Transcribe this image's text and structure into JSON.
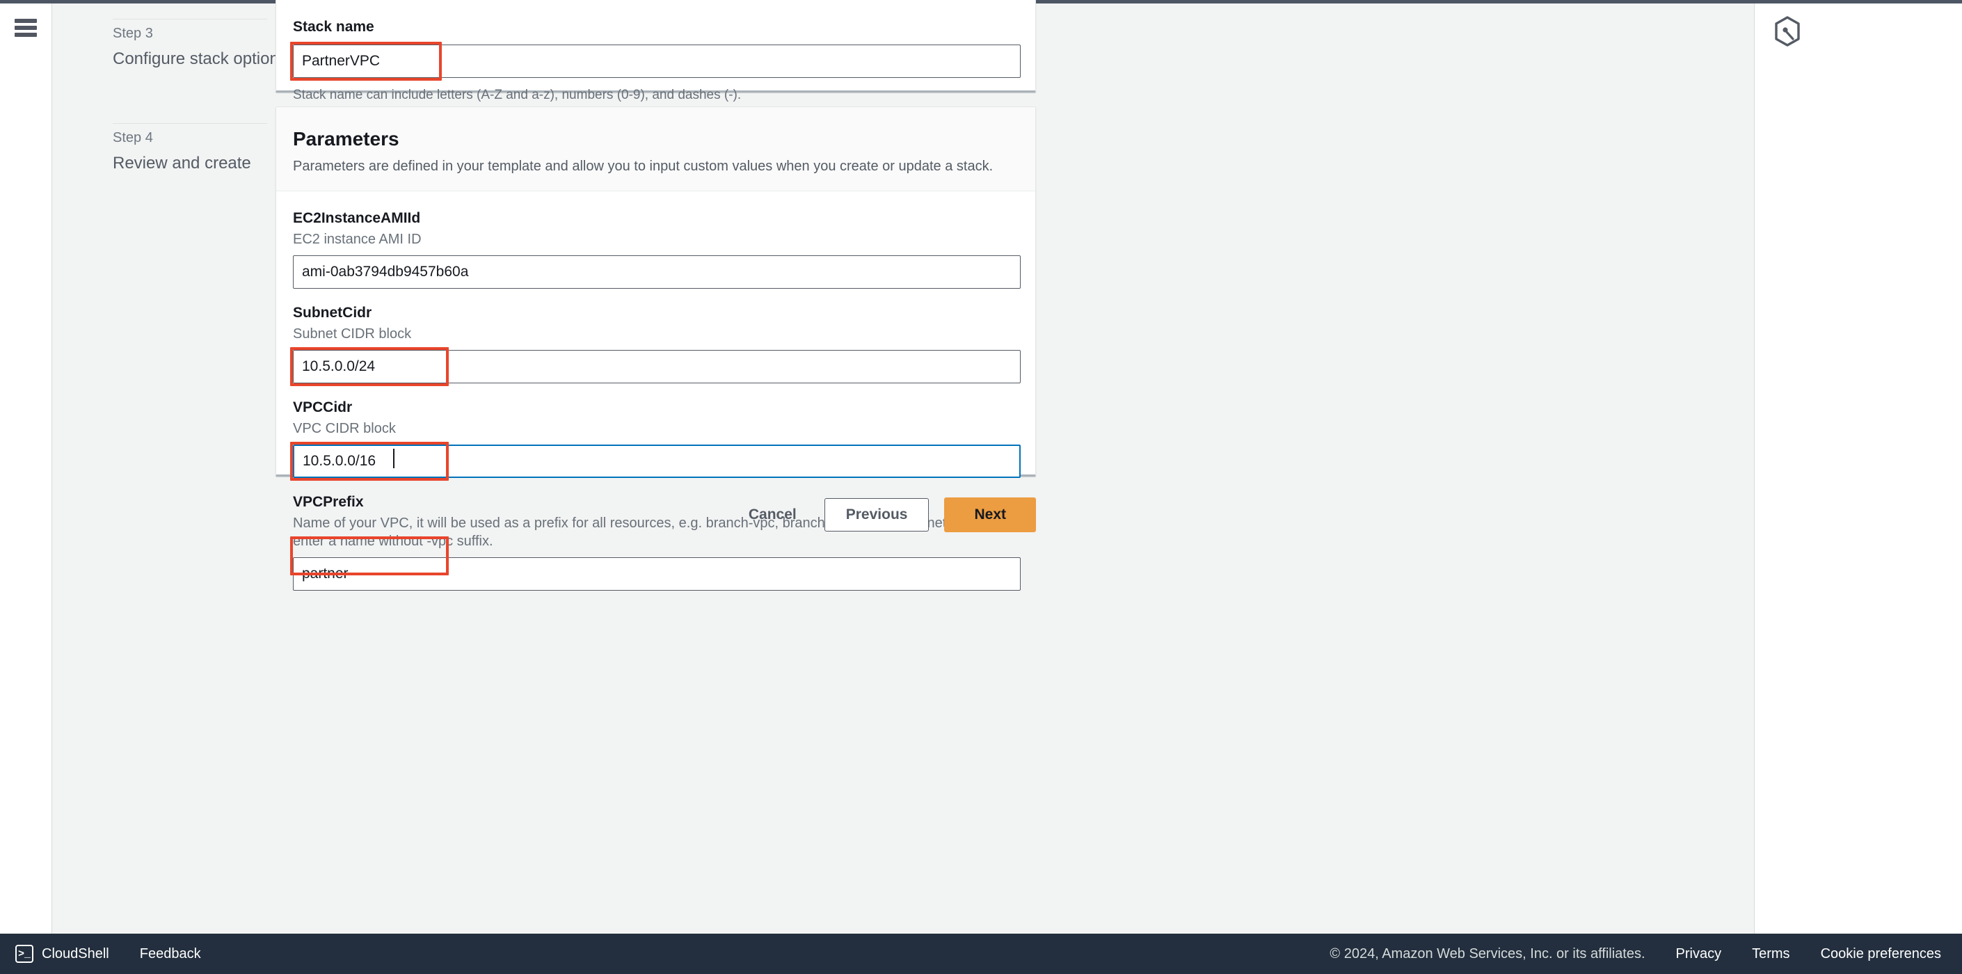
{
  "wizard": {
    "steps": [
      {
        "number": "Step 3",
        "title": "Configure stack options"
      },
      {
        "number": "Step 4",
        "title": "Review and create"
      }
    ]
  },
  "stack_name_card": {
    "label": "Stack name",
    "value": "PartnerVPC",
    "hint": "Stack name can include letters (A-Z and a-z), numbers (0-9), and dashes (-)."
  },
  "parameters": {
    "title": "Parameters",
    "description": "Parameters are defined in your template and allow you to input custom values when you create or update a stack.",
    "items": [
      {
        "name": "EC2InstanceAMIId",
        "description": "EC2 instance AMI ID",
        "value": "ami-0ab3794db9457b60a",
        "highlighted": false,
        "focused": false
      },
      {
        "name": "SubnetCidr",
        "description": "Subnet CIDR block",
        "value": "10.5.0.0/24",
        "highlighted": true,
        "focused": false
      },
      {
        "name": "VPCCidr",
        "description": "VPC CIDR block",
        "value": "10.5.0.0/16",
        "highlighted": true,
        "focused": true
      },
      {
        "name": "VPCPrefix",
        "description": "Name of your VPC, it will be used as a prefix for all resources, e.g. branch-vpc, branch-igw, branch-subnet,... Please enter a name without -vpc suffix.",
        "value": "partner",
        "highlighted": true,
        "focused": false
      }
    ]
  },
  "actions": {
    "cancel": "Cancel",
    "previous": "Previous",
    "next": "Next"
  },
  "right_panel": {
    "icon": "q-assistant-icon"
  },
  "footer": {
    "cloudshell": "CloudShell",
    "cloudshell_glyph": ">_",
    "feedback": "Feedback",
    "copyright": "© 2024, Amazon Web Services, Inc. or its affiliates.",
    "privacy": "Privacy",
    "terms": "Terms",
    "cookie_preferences": "Cookie preferences"
  },
  "colors": {
    "annotation": "#e8452c",
    "primary_button": "#ec9c41",
    "focus_border": "#0073bb",
    "footer_bg": "#232f3e"
  }
}
